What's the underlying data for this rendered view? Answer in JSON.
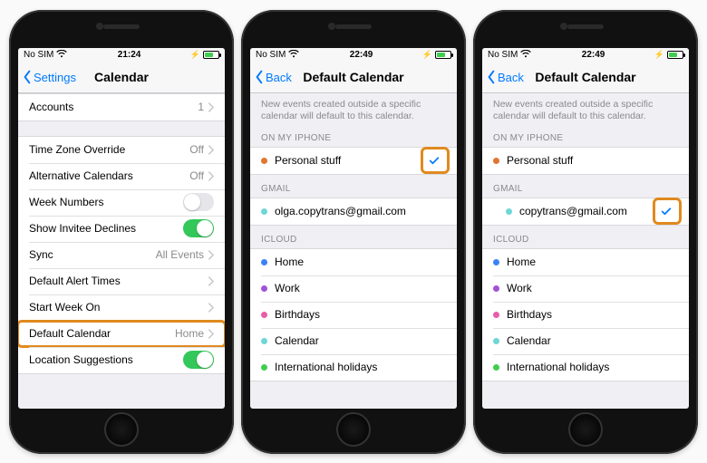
{
  "colors": {
    "accent": "#007aff",
    "highlight": "#e08a1f",
    "toggle_on": "#34c759"
  },
  "phone1": {
    "status": {
      "carrier": "No SIM",
      "time": "21:24"
    },
    "nav": {
      "back": "Settings",
      "title": "Calendar"
    },
    "groups": [
      {
        "rows": [
          {
            "label": "Accounts",
            "value": "1",
            "type": "disclosure"
          }
        ]
      },
      {
        "rows": [
          {
            "label": "Time Zone Override",
            "value": "Off",
            "type": "disclosure"
          },
          {
            "label": "Alternative Calendars",
            "value": "Off",
            "type": "disclosure"
          },
          {
            "label": "Week Numbers",
            "type": "toggle",
            "on": false
          },
          {
            "label": "Show Invitee Declines",
            "type": "toggle",
            "on": true
          },
          {
            "label": "Sync",
            "value": "All Events",
            "type": "disclosure"
          },
          {
            "label": "Default Alert Times",
            "type": "disclosure"
          },
          {
            "label": "Start Week On",
            "type": "disclosure"
          },
          {
            "label": "Default Calendar",
            "value": "Home",
            "type": "disclosure",
            "highlighted": true
          },
          {
            "label": "Location Suggestions",
            "type": "toggle",
            "on": true
          }
        ]
      }
    ]
  },
  "phone2": {
    "status": {
      "carrier": "No SIM",
      "time": "22:49"
    },
    "nav": {
      "back": "Back",
      "title": "Default Calendar"
    },
    "helper": "New events created outside a specific calendar will default to this calendar.",
    "groups": [
      {
        "header": "ON MY IPHONE",
        "rows": [
          {
            "dot": "#e2762f",
            "label": "Personal stuff",
            "checked": true,
            "checkHighlighted": true
          }
        ]
      },
      {
        "header": "GMAIL",
        "rows": [
          {
            "dot": "#6fd6d6",
            "label": "olga.copytrans@gmail.com"
          }
        ]
      },
      {
        "header": "ICLOUD",
        "rows": [
          {
            "dot": "#3b82f6",
            "label": "Home"
          },
          {
            "dot": "#a252d6",
            "label": "Work"
          },
          {
            "dot": "#e85da8",
            "label": "Birthdays"
          },
          {
            "dot": "#6fd6d6",
            "label": "Calendar"
          },
          {
            "dot": "#3fce4f",
            "label": "International holidays"
          }
        ]
      }
    ]
  },
  "phone3": {
    "status": {
      "carrier": "No SIM",
      "time": "22:49"
    },
    "nav": {
      "back": "Back",
      "title": "Default Calendar"
    },
    "helper": "New events created outside a specific calendar will default to this calendar.",
    "groups": [
      {
        "header": "ON MY IPHONE",
        "rows": [
          {
            "dot": "#e2762f",
            "label": "Personal stuff"
          }
        ]
      },
      {
        "header": "GMAIL",
        "rows": [
          {
            "dot": "#6fd6d6",
            "label": "copytrans@gmail.com",
            "indent": true,
            "checked": true,
            "checkHighlighted": true
          }
        ]
      },
      {
        "header": "ICLOUD",
        "rows": [
          {
            "dot": "#3b82f6",
            "label": "Home"
          },
          {
            "dot": "#a252d6",
            "label": "Work"
          },
          {
            "dot": "#e85da8",
            "label": "Birthdays"
          },
          {
            "dot": "#6fd6d6",
            "label": "Calendar"
          },
          {
            "dot": "#3fce4f",
            "label": "International holidays"
          }
        ]
      }
    ]
  }
}
